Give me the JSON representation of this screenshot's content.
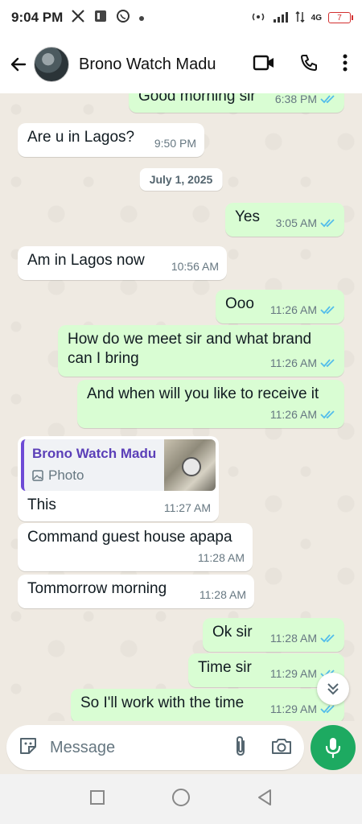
{
  "status": {
    "time": "9:04 PM",
    "battery": "7",
    "network": "4G"
  },
  "header": {
    "contact_name": "Brono Watch Madu"
  },
  "messages": [
    {
      "text": "Good morning sir",
      "time": "6:38 PM"
    },
    {
      "text": "Are u in Lagos?",
      "time": "9:50 PM"
    },
    {
      "date": "July 1, 2025"
    },
    {
      "text": "Yes",
      "time": "3:05 AM"
    },
    {
      "text": "Am in Lagos now",
      "time": "10:56 AM"
    },
    {
      "text": "Ooo",
      "time": "11:26 AM"
    },
    {
      "line1": "How do we meet sir and what brand",
      "line2": "can I bring",
      "time": "11:26 AM"
    },
    {
      "text": "And when will you like to receive it",
      "time": "11:26 AM"
    },
    {
      "quote_name": "Brono Watch Madu",
      "quote_type": "Photo",
      "text": "This",
      "time": "11:27 AM"
    },
    {
      "text": "Command guest house apapa",
      "time": "11:28 AM"
    },
    {
      "text": "Tommorrow morning",
      "time": "11:28 AM"
    },
    {
      "text": "Ok sir",
      "time": "11:28 AM"
    },
    {
      "text": "Time sir",
      "time": "11:29 AM"
    },
    {
      "text": "So I'll work with the time",
      "time": "11:29 AM"
    }
  ],
  "composer": {
    "placeholder": "Message"
  },
  "colors": {
    "accent": "#1daa61",
    "outgoing_bubble": "#d9fdd3",
    "incoming_bubble": "#ffffff",
    "read_ticks": "#53bdeb",
    "chat_background": "#efeae2"
  },
  "icons": {
    "status": [
      "x-icon",
      "notification-icon",
      "whatsapp-icon",
      "dot-icon",
      "hotspot-icon",
      "signal-icon",
      "data-icon",
      "battery-icon"
    ],
    "header": [
      "back-arrow-icon",
      "video-call-icon",
      "phone-icon",
      "more-vert-icon"
    ],
    "composer": [
      "sticker-icon",
      "attach-icon",
      "camera-icon",
      "mic-icon"
    ],
    "nav": [
      "recents-square-icon",
      "home-circle-icon",
      "back-triangle-icon"
    ]
  }
}
